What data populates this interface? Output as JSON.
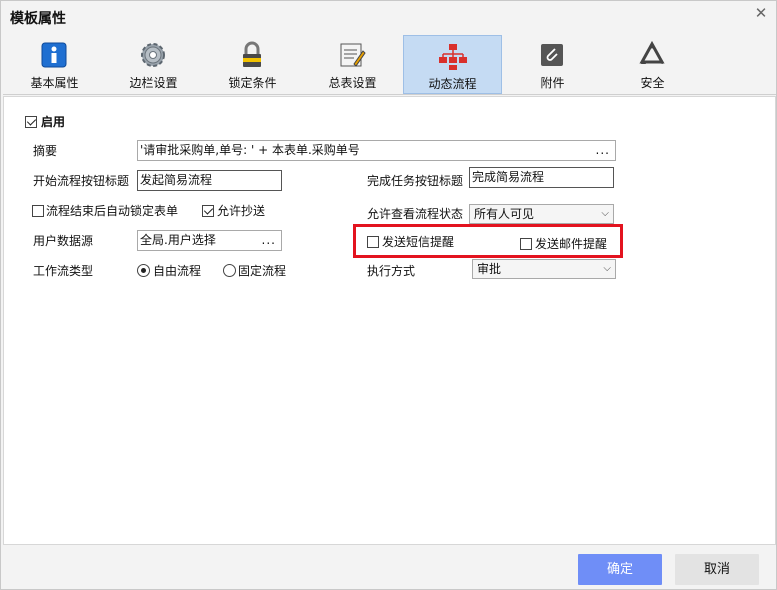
{
  "window": {
    "title": "模板属性",
    "close_glyph": "✕"
  },
  "tabs": [
    {
      "label": "基本属性",
      "icon": "info-icon",
      "active": false
    },
    {
      "label": "边栏设置",
      "icon": "gear-icon",
      "active": false
    },
    {
      "label": "锁定条件",
      "icon": "lock-icon",
      "active": false
    },
    {
      "label": "总表设置",
      "icon": "edit-sheet-icon",
      "active": false
    },
    {
      "label": "动态流程",
      "icon": "flowchart-icon",
      "active": true
    },
    {
      "label": "附件",
      "icon": "paperclip-icon",
      "active": false
    },
    {
      "label": "安全",
      "icon": "recycle-icon",
      "active": false
    }
  ],
  "form": {
    "enable": {
      "label": "启用",
      "checked": true
    },
    "summary": {
      "label": "摘要",
      "value": "'请审批采购单,单号: ' + 本表单.采购单号",
      "button": "..."
    },
    "start_title": {
      "label": "开始流程按钮标题",
      "value": "发起简易流程"
    },
    "finish_title": {
      "label": "完成任务按钮标题",
      "value": "完成简易流程"
    },
    "auto_lock": {
      "label": "流程结束后自动锁定表单",
      "checked": false
    },
    "allow_cc": {
      "label": "允许抄送",
      "checked": true
    },
    "view_status": {
      "label": "允许查看流程状态",
      "value": "所有人可见"
    },
    "user_source": {
      "label": "用户数据源",
      "value": "全局.用户选择",
      "button": "..."
    },
    "sms_notify": {
      "label": "发送短信提醒",
      "checked": false
    },
    "email_notify": {
      "label": "发送邮件提醒",
      "checked": false
    },
    "workflow_type": {
      "label": "工作流类型",
      "options": [
        "自由流程",
        "固定流程"
      ],
      "selected": "自由流程"
    },
    "exec_mode": {
      "label": "执行方式",
      "value": "审批"
    }
  },
  "footer": {
    "ok_label": "确定",
    "cancel_label": "取消"
  },
  "colors": {
    "highlight_border": "#e3131f",
    "primary_button": "#6f8ef7",
    "active_tab": "#c5dbf3"
  }
}
